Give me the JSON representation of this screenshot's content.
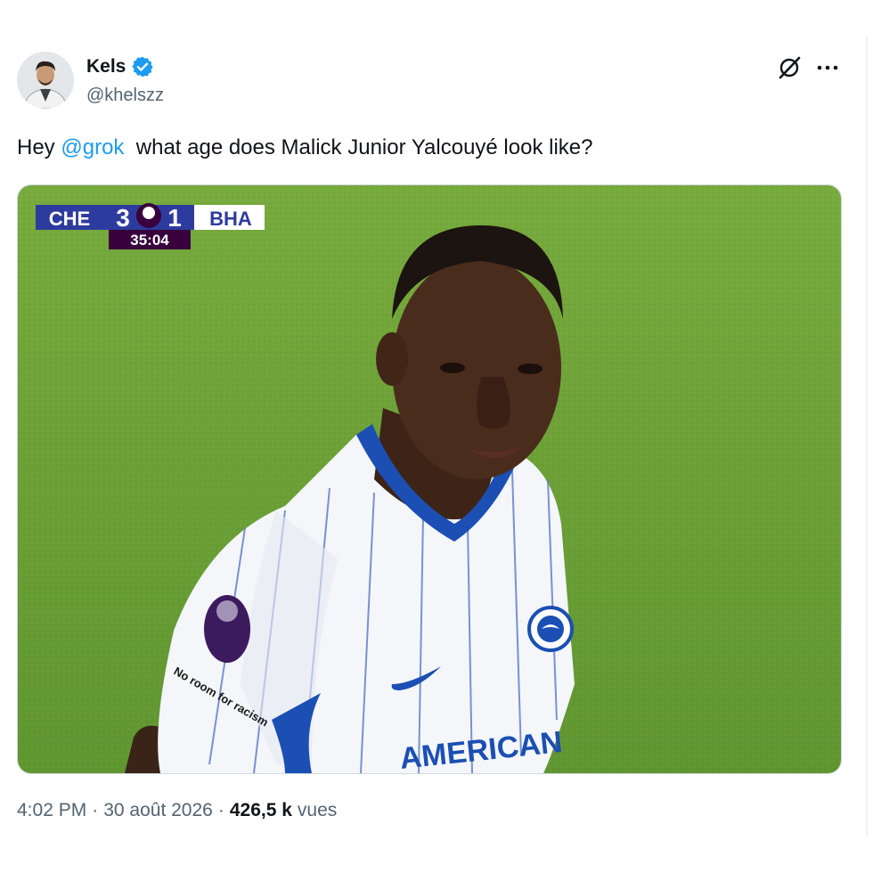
{
  "author": {
    "display_name": "Kels",
    "handle": "@khelszz",
    "verified_icon": "verified-badge-icon",
    "avatar_icon": "avatar"
  },
  "actions": {
    "grok_icon": "grok-icon",
    "more_icon": "more-icon"
  },
  "tweet": {
    "prefix": "Hey ",
    "mention": "@grok",
    "body": "  what age does Malick Junior Yalcouyé look like?"
  },
  "media": {
    "scoreboard": {
      "home": "CHE",
      "home_score": "3",
      "away_score": "1",
      "away": "BHA",
      "clock": "35:04"
    },
    "shirt_sponsor": "AMERICAN",
    "sleeve_patch": "No room for racism",
    "colors": {
      "pitch": "#6a9e35",
      "scoreboard_blue": "#2e3b9e",
      "scoreboard_purple": "#38003c",
      "kit_blue": "#1b4fb3"
    }
  },
  "meta": {
    "time": "4:02 PM",
    "sep1": "·",
    "date": "30 août 2026",
    "sep2": "·",
    "views_count": "426,5 k",
    "views_label": "vues"
  }
}
